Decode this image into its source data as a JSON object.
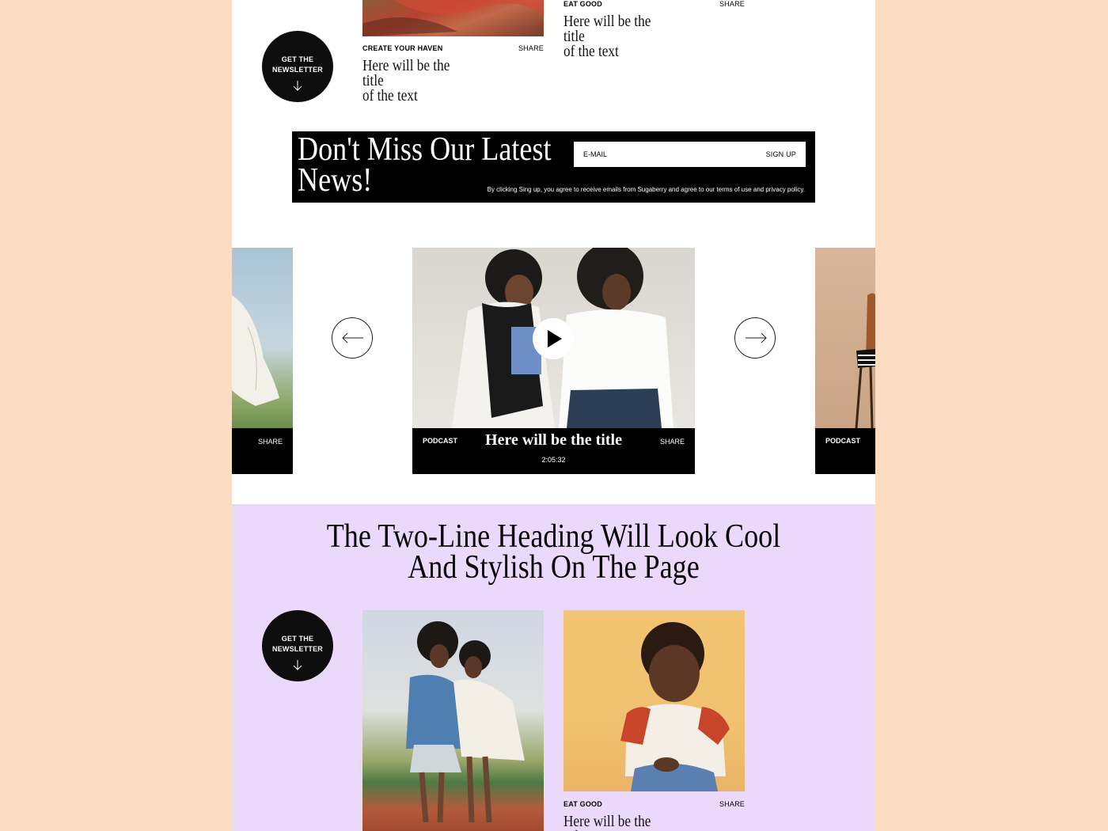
{
  "newsletter_circle": {
    "label": "GET THE\nNEWSLETTER"
  },
  "top_cards": [
    {
      "category": "CREATE YOUR HAVEN",
      "share": "SHARE",
      "title": "Here will be the title\nof the text"
    },
    {
      "category": "EAT GOOD",
      "share": "SHARE",
      "title": "Here will be the title\nof the text"
    }
  ],
  "banner": {
    "heading": "Don't Miss Our Latest\nNews!",
    "email_placeholder": "E-MAIL",
    "signup_label": "SIGN UP",
    "legal": "By clicking Sing up, you agree to receive emails from Sugaberry and agree to our terms of use and privacy policy."
  },
  "slider": {
    "left": {
      "share": "SHARE"
    },
    "center": {
      "category": "PODCAST",
      "title": "Here will be the title",
      "share": "SHARE",
      "duration": "2:05:32"
    },
    "right": {
      "category": "PODCAST"
    }
  },
  "section": {
    "heading": "The Two-Line Heading Will Look Cool\nAnd Stylish On The Page",
    "newsletter_label": "GET THE\nNEWSLETTER",
    "card": {
      "category": "EAT GOOD",
      "share": "SHARE",
      "title": "Here will be the title"
    }
  },
  "colors": {
    "page_bg": "#fcdcc3",
    "panel": "#ffffff",
    "lavender": "#ead9fb",
    "ink": "#000000"
  }
}
